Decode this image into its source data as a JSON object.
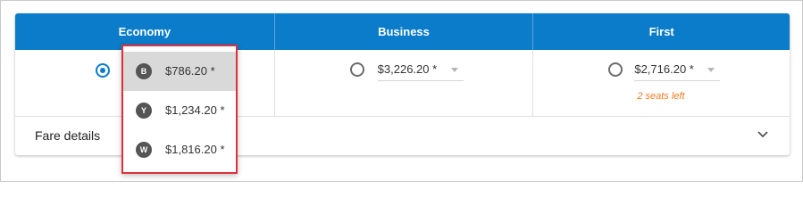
{
  "columns": [
    {
      "key": "economy",
      "label": "Economy"
    },
    {
      "key": "business",
      "label": "Business"
    },
    {
      "key": "first",
      "label": "First"
    }
  ],
  "business": {
    "price": "$3,226.20 *"
  },
  "first": {
    "price": "$2,716.20 *",
    "note": "2 seats left"
  },
  "fare_details": {
    "label": "Fare details"
  },
  "dropdown": {
    "options": [
      {
        "code": "B",
        "price": "$786.20 *",
        "selected": true
      },
      {
        "code": "Y",
        "price": "$1,234.20 *",
        "selected": false
      },
      {
        "code": "W",
        "price": "$1,816.20 *",
        "selected": false
      }
    ]
  },
  "colors": {
    "header": "#0a7cc9",
    "radio_selected": "#0a7cc9",
    "seats_note": "#f47b20",
    "dropdown_border": "#e0303c",
    "badge": "#555555"
  },
  "icons": {
    "expand": "chevron-down-icon",
    "select_caret": "caret-down-icon"
  }
}
